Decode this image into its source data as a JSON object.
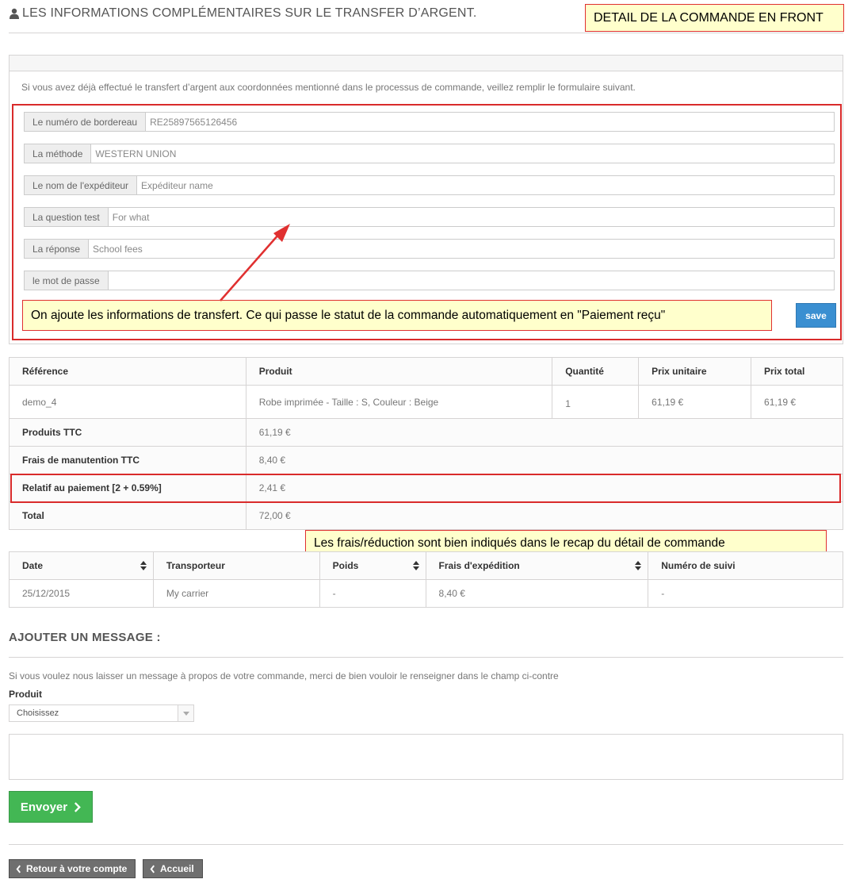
{
  "header": {
    "title": "LES INFORMATIONS COMPLÉMENTAIRES SUR LE TRANSFER D’ARGENT.",
    "icon": "user-icon"
  },
  "annotations": {
    "top_right": "DETAIL DE LA COMMANDE EN FRONT",
    "form_note": "On ajoute les informations de transfert. Ce qui passe le statut de la commande automatiquement en \"Paiement reçu\"",
    "recap_note": "Les frais/réduction sont bien indiqués dans le recap du détail de commande",
    "annotation_color": "#d92b2b",
    "note_bg": "#ffffcc"
  },
  "transfer_form": {
    "intro": "Si vous avez déjà effectué le transfert d’argent aux coordonnées mentionné dans le processus de commande, veillez remplir le formulaire suivant.",
    "fields": [
      {
        "label": "Le numéro de bordereau",
        "value": "RE25897565126456"
      },
      {
        "label": "La méthode",
        "value": "WESTERN UNION"
      },
      {
        "label": "Le nom de l'expéditeur",
        "value": "Expéditeur name"
      },
      {
        "label": "La question test",
        "value": "For what"
      },
      {
        "label": "La réponse",
        "value": "School fees"
      },
      {
        "label": "le mot de passe",
        "value": ""
      }
    ],
    "save_label": "save"
  },
  "order_table": {
    "headers": [
      "Référence",
      "Produit",
      "Quantité",
      "Prix unitaire",
      "Prix total"
    ],
    "rows": [
      {
        "reference": "demo_4",
        "product": "Robe imprimée - Taille : S, Couleur : Beige",
        "quantity": "1",
        "unit_price": "61,19 €",
        "total_price": "61,19 €"
      }
    ],
    "totals": [
      {
        "label": "Produits TTC",
        "value": "61,19 €"
      },
      {
        "label": "Frais de manutention TTC",
        "value": "8,40 €"
      },
      {
        "label": "Relatif au paiement [2 + 0.59%]",
        "value": "2,41 €"
      },
      {
        "label": "Total",
        "value": "72,00 €"
      }
    ]
  },
  "shipping_table": {
    "headers": [
      "Date",
      "Transporteur",
      "Poids",
      "Frais d'expédition",
      "Numéro de suivi"
    ],
    "rows": [
      {
        "date": "25/12/2015",
        "carrier": "My carrier",
        "weight": "-",
        "shipping_cost": "8,40 €",
        "tracking": "-"
      }
    ]
  },
  "message": {
    "heading": "AJOUTER UN MESSAGE :",
    "intro": "Si vous voulez nous laisser un message à propos de votre commande, merci de bien vouloir le renseigner dans le champ ci-contre",
    "product_label": "Produit",
    "select_value": "Choisissez",
    "send_label": "Envoyer"
  },
  "footer": {
    "back_account": "Retour à votre compte",
    "home": "Accueil"
  },
  "colors": {
    "save_button": "#3a8fd1",
    "send_button": "#43b754",
    "nav_button": "#6f6f6f"
  }
}
